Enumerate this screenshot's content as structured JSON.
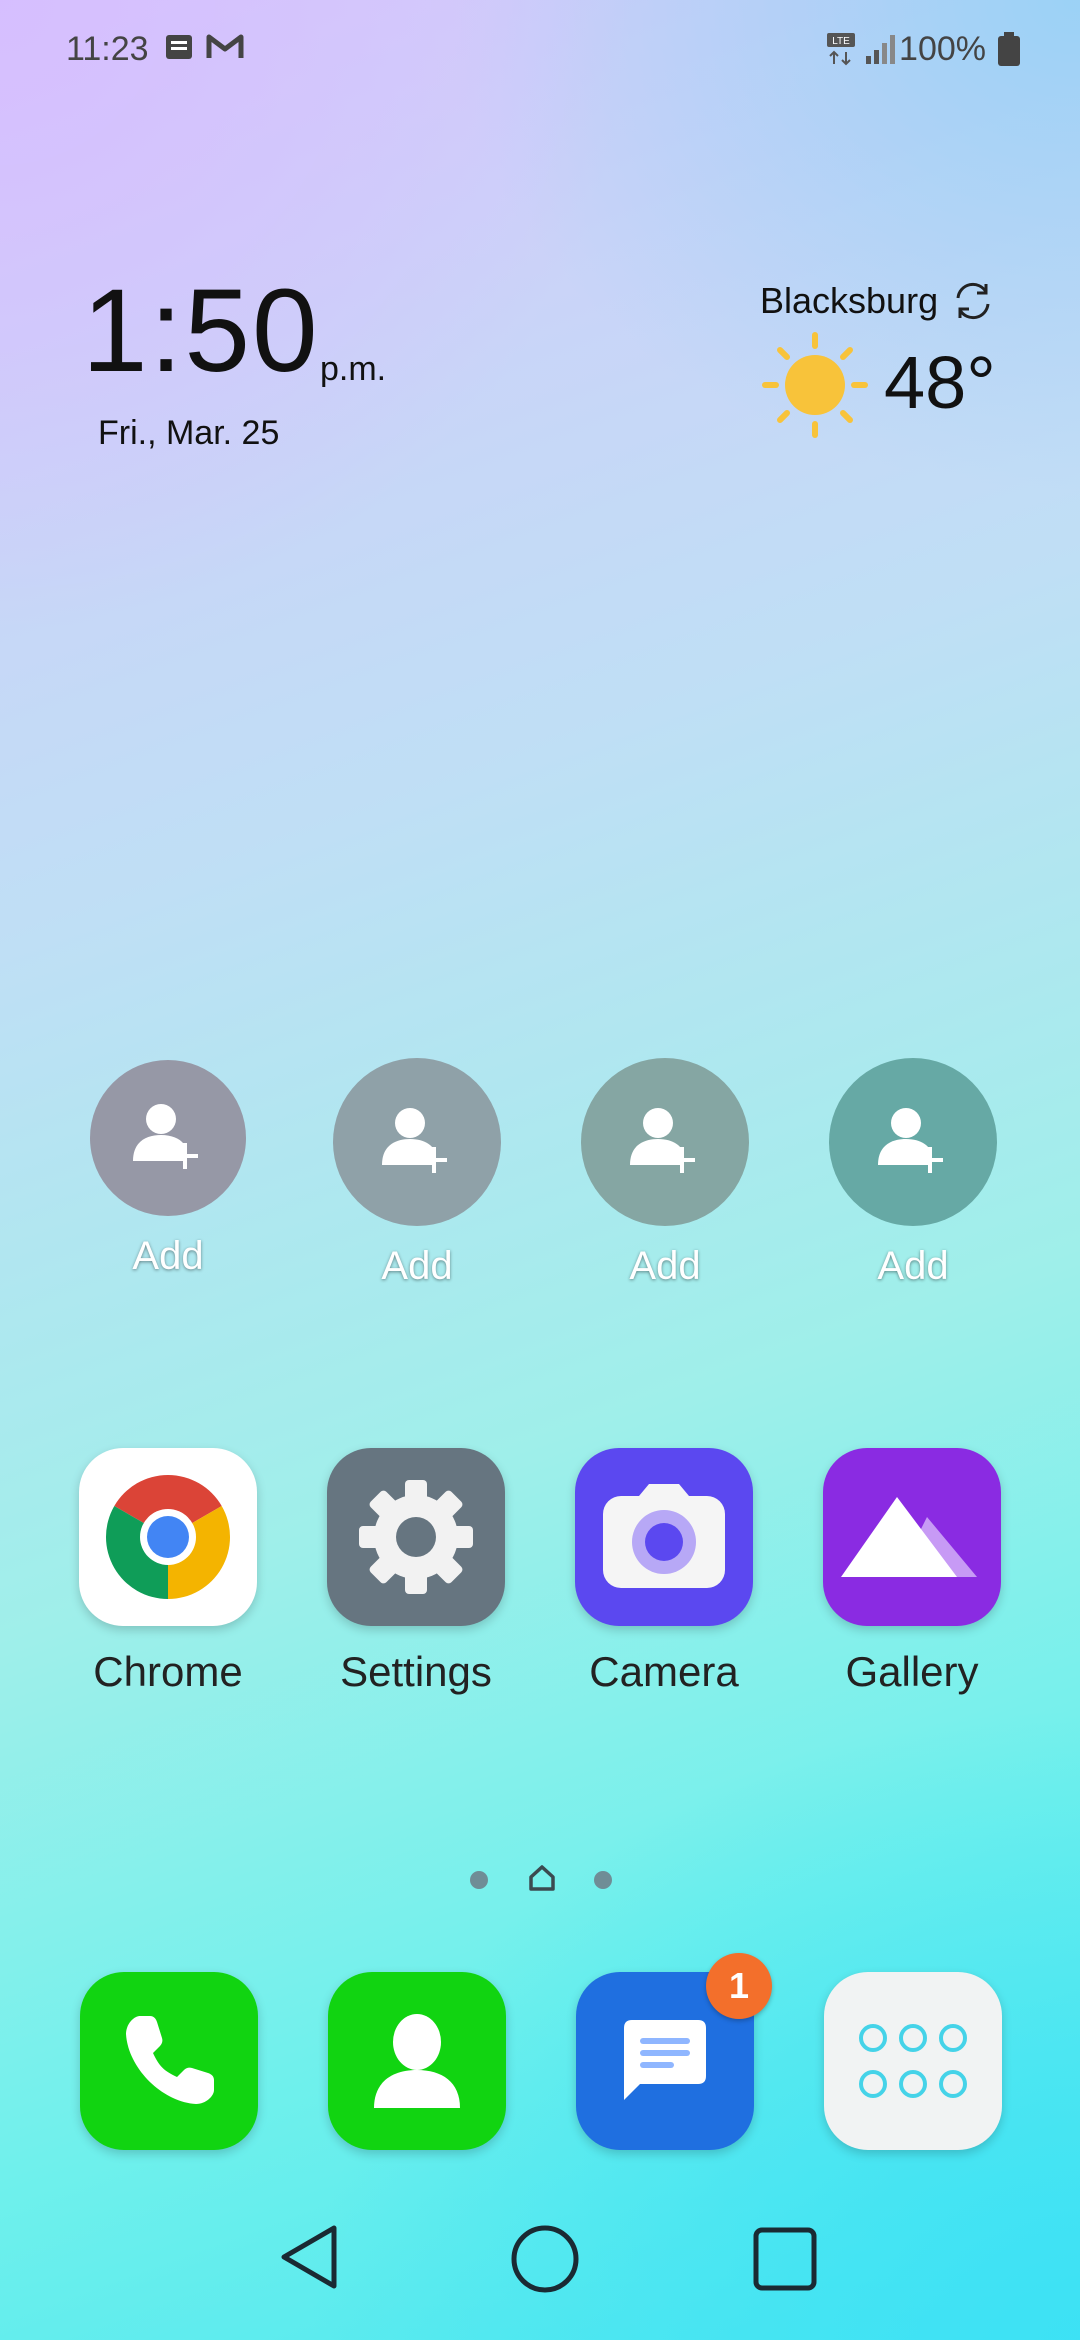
{
  "status_bar": {
    "time": "11:23",
    "network_badge": "LTE",
    "battery_text": "100%",
    "icons": [
      "message-notification-icon",
      "gmail-icon",
      "lte-icon",
      "signal-icon",
      "battery-icon"
    ]
  },
  "clock_widget": {
    "time": "1:50",
    "ampm": "p.m.",
    "date": "Fri., Mar. 25"
  },
  "weather_widget": {
    "city": "Blacksburg",
    "temperature": "48°",
    "condition_icon": "sun-icon",
    "refresh_icon": "refresh-icon"
  },
  "contact_shortcuts": [
    {
      "label": "Add"
    },
    {
      "label": "Add"
    },
    {
      "label": "Add"
    },
    {
      "label": "Add"
    }
  ],
  "apps": [
    {
      "label": "Chrome",
      "icon": "chrome-icon"
    },
    {
      "label": "Settings",
      "icon": "gear-icon"
    },
    {
      "label": "Camera",
      "icon": "camera-icon"
    },
    {
      "label": "Gallery",
      "icon": "gallery-icon"
    }
  ],
  "page_indicator": {
    "pages": 3,
    "current": "home"
  },
  "dock": {
    "items": [
      {
        "name": "phone",
        "icon": "phone-icon"
      },
      {
        "name": "contacts",
        "icon": "contacts-icon"
      },
      {
        "name": "messages",
        "icon": "messages-icon",
        "badge": "1"
      },
      {
        "name": "app-drawer",
        "icon": "app-drawer-icon"
      }
    ]
  },
  "colors": {
    "phone_green": "#11d411",
    "messages_blue": "#1f6fe0",
    "camera_blue": "#5b48f0",
    "gallery_purple": "#8a2be2",
    "settings_gray": "#667580",
    "badge_orange": "#f36f2b"
  },
  "nav_bar": {
    "buttons": [
      "back",
      "home",
      "recents"
    ]
  }
}
